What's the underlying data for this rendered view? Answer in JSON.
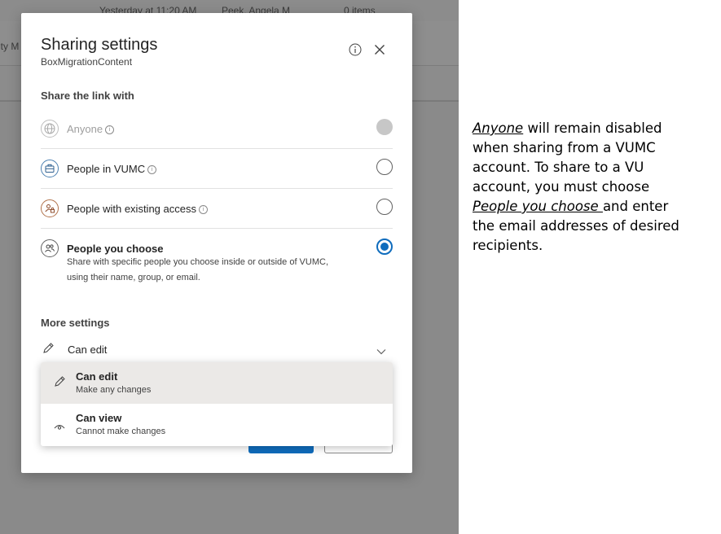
{
  "background": {
    "row1": {
      "date": "Yesterday at 11:20 AM",
      "owner": "Peek, Angela M",
      "items": "0 items"
    },
    "row2_fragment": "ity M"
  },
  "dialog": {
    "title": "Sharing settings",
    "subtitle": "BoxMigrationContent",
    "info_icon": "info-icon",
    "close_icon": "close-icon",
    "share_heading": "Share the link with",
    "options": [
      {
        "label": "Anyone",
        "icon": "globe-icon",
        "info": true,
        "state": "disabled"
      },
      {
        "label": "People in VUMC",
        "icon": "briefcase-icon",
        "info": true,
        "state": "unchecked"
      },
      {
        "label": "People with existing access",
        "icon": "people-lock-icon",
        "info": true,
        "state": "unchecked"
      },
      {
        "label": "People you choose",
        "icon": "people-icon",
        "info": false,
        "state": "checked",
        "description": "Share with specific people you choose inside or outside of VUMC, using their name, group, or email."
      }
    ],
    "more_heading": "More settings",
    "permission": {
      "value": "Can edit",
      "icon": "pencil-icon",
      "chevron": "chevron-down-icon"
    },
    "permission_menu": [
      {
        "label": "Can edit",
        "desc": "Make any changes",
        "icon": "pencil-icon",
        "selected": true
      },
      {
        "label": "Can view",
        "desc": "Cannot make changes",
        "icon": "eye-icon",
        "selected": false
      }
    ]
  },
  "note": {
    "anyone": "Anyone",
    "part1": " will remain disabled when sharing from a VUMC account. To share to a VU account, you must choose ",
    "people_you_choose": "People you choose ",
    "part2": "and enter the email addresses of desired recipients."
  },
  "colors": {
    "accent": "#0f6cbd",
    "overlay": "#8a8a8a",
    "selected_row": "#ebe9e7"
  }
}
